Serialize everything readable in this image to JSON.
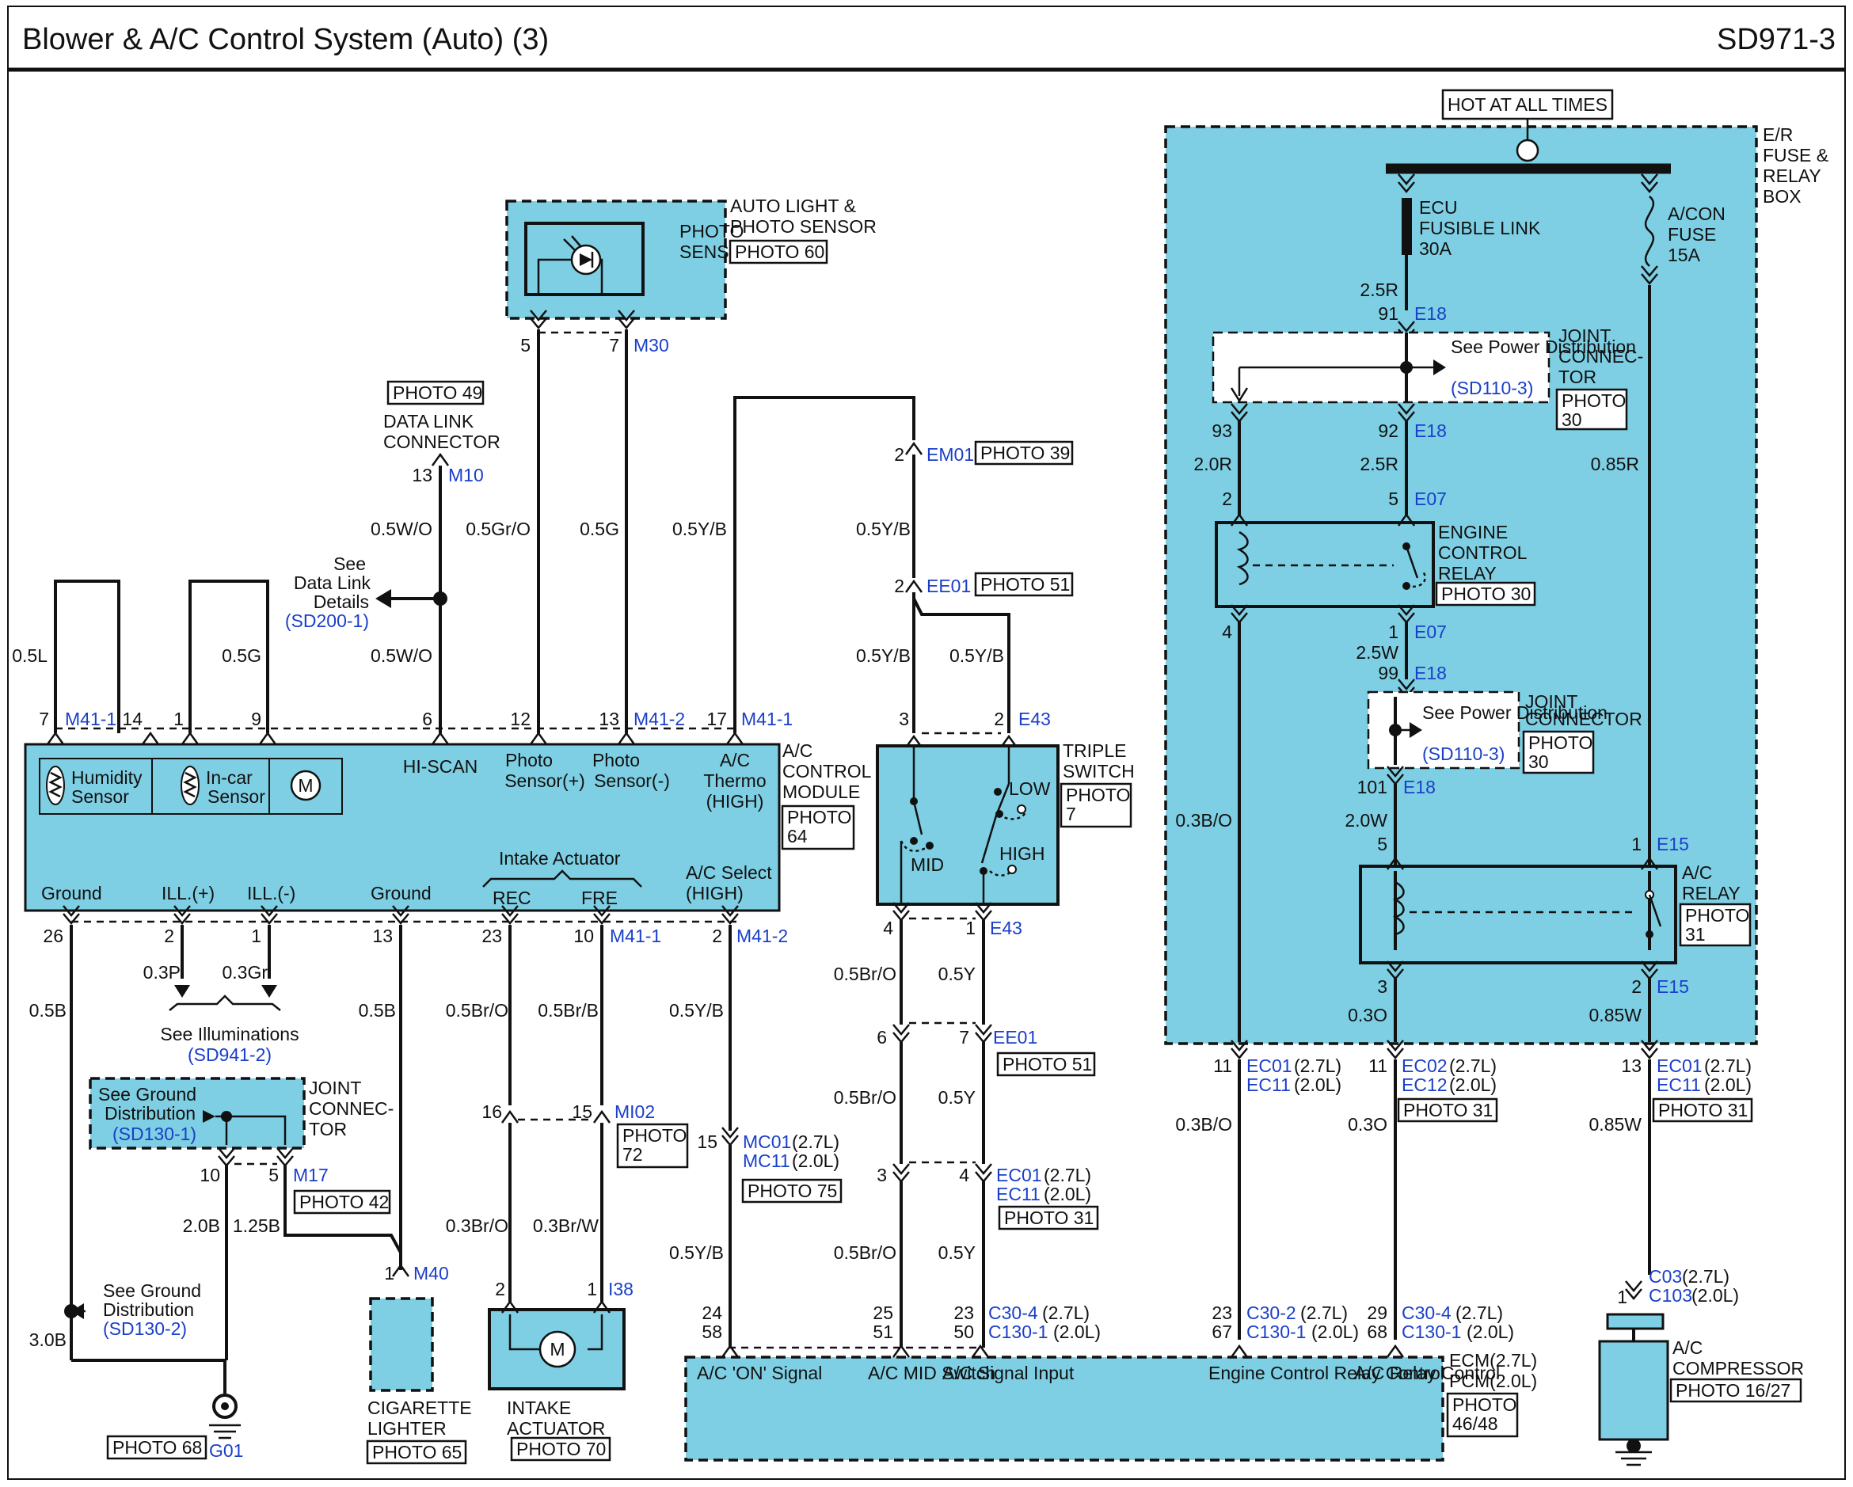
{
  "header": {
    "title": "Blower & A/C Control System (Auto) (3)",
    "code": "SD971-3"
  },
  "power": {
    "hot": "HOT AT ALL TIMES",
    "box_label": "E/R FUSE & RELAY BOX"
  },
  "fuses": {
    "ecu": "ECU FUSIBLE LINK 30A",
    "acon": "A/CON FUSE 15A"
  },
  "components": {
    "photo_sensor": "PHOTO SENSOR",
    "auto_light": "AUTO LIGHT & PHOTO SENSOR",
    "dlc": "DATA LINK CONNECTOR",
    "acm": "A/C CONTROL MODULE",
    "triple": "TRIPLE SWITCH",
    "ecr": "ENGINE CONTROL RELAY",
    "acr": "A/C RELAY",
    "joint": "JOINT CONNECTOR",
    "joint_short": "JOINT CONNEC-TOR",
    "cig": "CIGARETTE LIGHTER",
    "intake": "INTAKE ACTUATOR",
    "compressor": "A/C COMPRESSOR",
    "ecm": "ECM(2.7L) PCM(2.0L)"
  },
  "photos": {
    "p60": "PHOTO 60",
    "p49": "PHOTO 49",
    "p39": "PHOTO 39",
    "p51": "PHOTO 51",
    "p64": "PHOTO 64",
    "p7": "PHOTO 7",
    "p30": "PHOTO 30",
    "p31": "PHOTO 31",
    "p42": "PHOTO 42",
    "p72": "PHOTO 72",
    "p75": "PHOTO 75",
    "p68": "PHOTO 68",
    "p65": "PHOTO 65",
    "p70": "PHOTO 70",
    "p4648": "PHOTO 46/48",
    "p1627": "PHOTO 16/27"
  },
  "acm_labels": {
    "humidity": "Humidity Sensor",
    "incar": "In-car Sensor",
    "hiscan": "HI-SCAN",
    "ps_plus": "Photo Sensor(+)",
    "ps_minus": "Photo Sensor(-)",
    "thermo": "A/C Thermo (HIGH)",
    "ground": "Ground",
    "ill_plus": "ILL.(+)",
    "ill_minus": "ILL.(-)",
    "intake": "Intake Actuator",
    "rec": "REC",
    "fre": "FRE",
    "select": "A/C Select (HIGH)"
  },
  "ecm_labels": {
    "on_signal": "A/C 'ON' Signal",
    "mid": "A/C MID Switch",
    "signal_input": "A/C Signal Input",
    "ecr_ctrl": "Engine Control Relay Control",
    "relay_ctrl": "A/C Relay Control"
  },
  "refs": {
    "see_data_link": "See Data Link Details",
    "sd200": "(SD200-1)",
    "see_power": "See Power Distribution",
    "sd110": "(SD110-3)",
    "see_ground": "See Ground Distribution",
    "sd1301": "(SD130-1)",
    "sd1302": "(SD130-2)",
    "see_illum": "See Illuminations",
    "sd941": "(SD941-2)"
  },
  "wires": {
    "w05l": "0.5L",
    "w05g": "0.5G",
    "w05wo": "0.5W/O",
    "w05gro": "0.5Gr/O",
    "w05yb": "0.5Y/B",
    "w05b": "0.5B",
    "w03p": "0.3P",
    "w03gr": "0.3Gr",
    "w05bro": "0.5Br/O",
    "w05brb": "0.5Br/B",
    "w05y": "0.5Y",
    "w20b": "2.0B",
    "w125b": "1.25B",
    "w30b": "3.0B",
    "w03bro": "0.3Br/O",
    "w03brw": "0.3Br/W",
    "w25r": "2.5R",
    "w20r": "2.0R",
    "w085r": "0.85R",
    "w25w": "2.5W",
    "w20w": "2.0W",
    "w03bo": "0.3B/O",
    "w03o": "0.3O",
    "w085w": "0.85W"
  },
  "connectors": {
    "M30": "M30",
    "M10": "M10",
    "M41_1": "M41-1",
    "M41_2": "M41-2",
    "EM01": "EM01",
    "EE01": "EE01",
    "E43": "E43",
    "E18": "E18",
    "E07": "E07",
    "E15": "E15",
    "M17": "M17",
    "M40": "M40",
    "MI02": "MI02",
    "I38": "I38",
    "G01": "G01",
    "MC01": "MC01",
    "MC11": "MC11",
    "EC01": "EC01",
    "EC11": "EC11",
    "EC02": "EC02",
    "EC12": "EC12",
    "C30_4": "C30-4",
    "C130_1": "C130-1",
    "C30_2": "C30-2",
    "C03": "C03",
    "C103": "C103",
    "l27": "(2.7L)",
    "l20": "(2.0L)"
  },
  "pins": {
    "p1": "1",
    "p2": "2",
    "p3": "3",
    "p4": "4",
    "p5": "5",
    "p6": "6",
    "p7": "7",
    "p9": "9",
    "p10": "10",
    "p11": "11",
    "p12": "12",
    "p13": "13",
    "p14": "14",
    "p15": "15",
    "p16": "16",
    "p17": "17",
    "p23": "23",
    "p24": "24",
    "p25": "25",
    "p26": "26",
    "p29": "29",
    "p50": "50",
    "p51": "51",
    "p58": "58",
    "p67": "67",
    "p68": "68",
    "p91": "91",
    "p92": "92",
    "p93": "93",
    "p99": "99",
    "p101": "101"
  },
  "switch_labels": {
    "low": "LOW",
    "mid": "MID",
    "high": "HIGH"
  },
  "colors": {
    "component_fill": "#7ecfe3",
    "connector_text": "#1a3fc9",
    "line": "#111111"
  }
}
